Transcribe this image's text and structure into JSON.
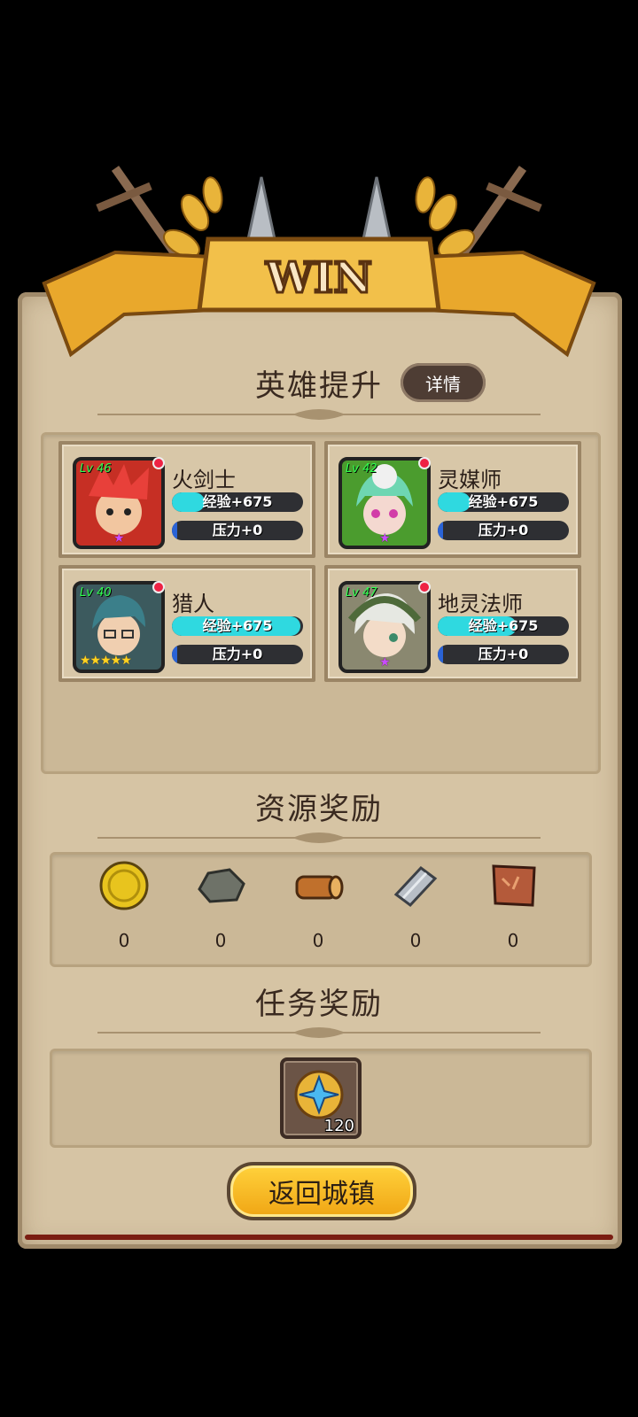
{
  "banner": {
    "title": "WIN"
  },
  "heroes_section": {
    "title": "英雄提升",
    "details_label": "详情"
  },
  "heroes": [
    {
      "name": "火剑士",
      "level": "Lv 46",
      "exp": "经验+675",
      "exp_fill": 0.25,
      "pressure": "压力+0",
      "pressure_fill": 0.04,
      "star_mark": "★",
      "colors": {
        "frame": "#c62f24",
        "hair": "#e8403a",
        "skin": "#f2c6a0"
      }
    },
    {
      "name": "灵媒师",
      "level": "Lv 42",
      "exp": "经验+675",
      "exp_fill": 0.25,
      "pressure": "压力+0",
      "pressure_fill": 0.04,
      "star_mark": "★",
      "colors": {
        "frame": "#4b9c2e",
        "hair": "#6ed6b2",
        "skin": "#f4d8d0"
      }
    },
    {
      "name": "猎人",
      "level": "Lv 40",
      "exp": "经验+675",
      "exp_fill": 0.98,
      "pressure": "压力+0",
      "pressure_fill": 0.04,
      "star_mark": "★★★★★",
      "colors": {
        "frame": "#3c5a5e",
        "hair": "#3b7f8a",
        "skin": "#f0cfb0"
      }
    },
    {
      "name": "地灵法师",
      "level": "Lv 47",
      "exp": "经验+675",
      "exp_fill": 0.6,
      "pressure": "压力+0",
      "pressure_fill": 0.04,
      "star_mark": "★",
      "colors": {
        "frame": "#8a8870",
        "hair": "#e6e8e2",
        "skin": "#f3dcc8"
      }
    }
  ],
  "resources_section": {
    "title": "资源奖励"
  },
  "resources": [
    {
      "icon": "gold-coin-icon",
      "count": "0"
    },
    {
      "icon": "stone-icon",
      "count": "0"
    },
    {
      "icon": "wood-log-icon",
      "count": "0"
    },
    {
      "icon": "iron-ingot-icon",
      "count": "0"
    },
    {
      "icon": "leather-icon",
      "count": "0"
    }
  ],
  "tasks_section": {
    "title": "任务奖励"
  },
  "task_reward": {
    "icon": "star-medal-icon",
    "count": "120"
  },
  "return_button": {
    "label": "返回城镇"
  }
}
